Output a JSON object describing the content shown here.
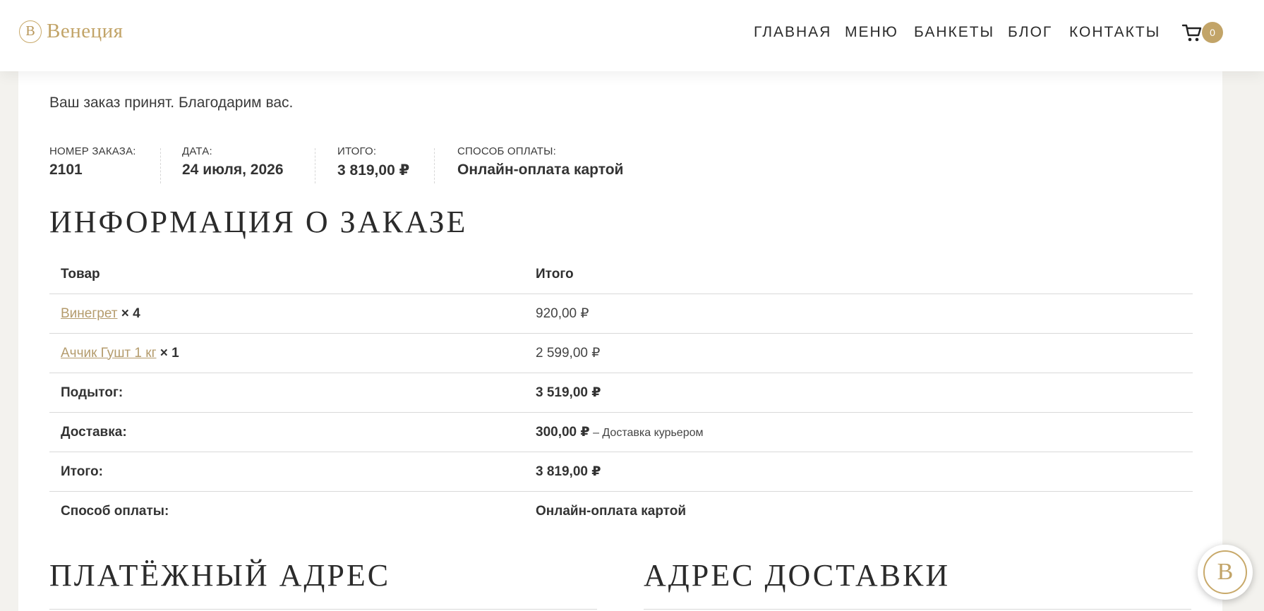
{
  "brand": {
    "logo_letter": "B",
    "name": "Венеция",
    "color": "#c2a468"
  },
  "nav": {
    "items": [
      {
        "label": "ГЛАВНАЯ"
      },
      {
        "label": "МЕНЮ"
      },
      {
        "label": "БАНКЕТЫ"
      },
      {
        "label": "БЛОГ"
      },
      {
        "label": "КОНТАКТЫ"
      }
    ],
    "cart_icon": "cart-icon",
    "cart_count": "0"
  },
  "thanks_text": "Ваш заказ принят. Благодарим вас.",
  "overview": {
    "order_number": {
      "label": "НОМЕР ЗАКАЗА:",
      "value": "2101"
    },
    "date": {
      "label": "ДАТА:",
      "value": "24 июля, 2026"
    },
    "total": {
      "label": "ИТОГО:",
      "value": "3 819,00 ₽"
    },
    "payment": {
      "label": "СПОСОБ ОПЛАТЫ:",
      "value": "Онлайн-оплата картой"
    }
  },
  "order_details": {
    "title": "ИНФОРМАЦИЯ О ЗАКАЗЕ",
    "columns": [
      "Товар",
      "Итого"
    ],
    "items": [
      {
        "name": "Винегрет",
        "qty": "× 4",
        "total": "920,00 ₽"
      },
      {
        "name": "Аччик Гушт 1 кг",
        "qty": "× 1",
        "total": "2 599,00 ₽"
      }
    ],
    "subtotal": {
      "label": "Подытог:",
      "value": "3 519,00 ₽"
    },
    "shipping": {
      "label": "Доставка:",
      "value": "300,00 ₽",
      "note": " – Доставка курьером"
    },
    "total": {
      "label": "Итого:",
      "value": "3 819,00 ₽"
    },
    "payment": {
      "label": "Способ оплаты:",
      "value": "Онлайн-оплата картой"
    }
  },
  "billing_title": "ПЛАТЁЖНЫЙ АДРЕС",
  "shipping_title": "АДРЕС ДОСТАВКИ",
  "floating_logo": {
    "letter": "B",
    "icon": "brand-badge-icon"
  }
}
